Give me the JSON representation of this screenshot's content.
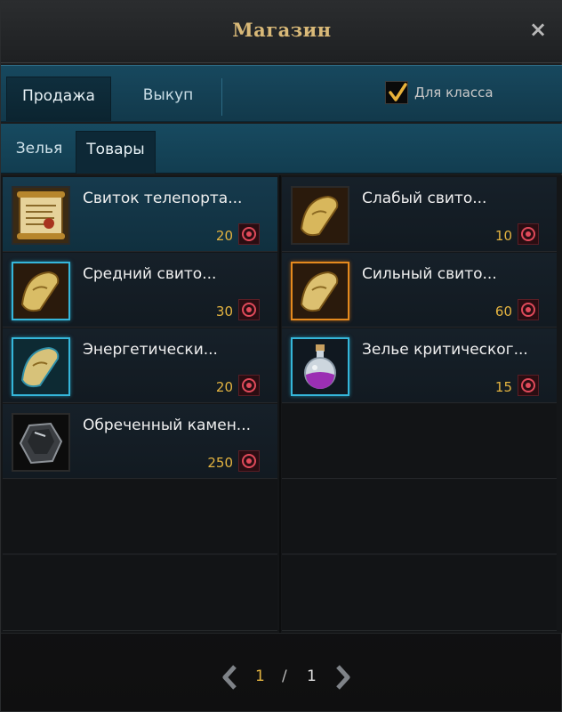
{
  "window": {
    "title": "Магазин",
    "close_glyph": "×"
  },
  "tabs": [
    {
      "label": "Продажа",
      "active": true
    },
    {
      "label": "Выкуп",
      "active": false
    }
  ],
  "class_filter": {
    "label": "Для класса",
    "checked": true
  },
  "subtabs": [
    {
      "label": "Зелья",
      "active": false
    },
    {
      "label": "Товары",
      "active": true
    }
  ],
  "items": [
    {
      "name": "Свиток телепорта...",
      "price": "20",
      "icon": "scroll-teleport-icon"
    },
    {
      "name": "Слабый свито...",
      "price": "10",
      "icon": "scroll-weak-icon"
    },
    {
      "name": "Средний свито...",
      "price": "30",
      "icon": "scroll-medium-icon"
    },
    {
      "name": "Сильный свито...",
      "price": "60",
      "icon": "scroll-strong-icon"
    },
    {
      "name": "Энергетически...",
      "price": "20",
      "icon": "scroll-energy-icon"
    },
    {
      "name": "Зелье критическог...",
      "price": "15",
      "icon": "potion-critical-icon"
    },
    {
      "name": "Обреченный камен...",
      "price": "250",
      "icon": "doomed-stone-icon"
    }
  ],
  "pagination": {
    "current": "1",
    "separator": "/",
    "total": "1"
  },
  "colors": {
    "accent_gold": "#e3b340",
    "tab_teal": "#17485e",
    "frame_blue": "#35b6da",
    "frame_orange": "#e58a1e"
  }
}
